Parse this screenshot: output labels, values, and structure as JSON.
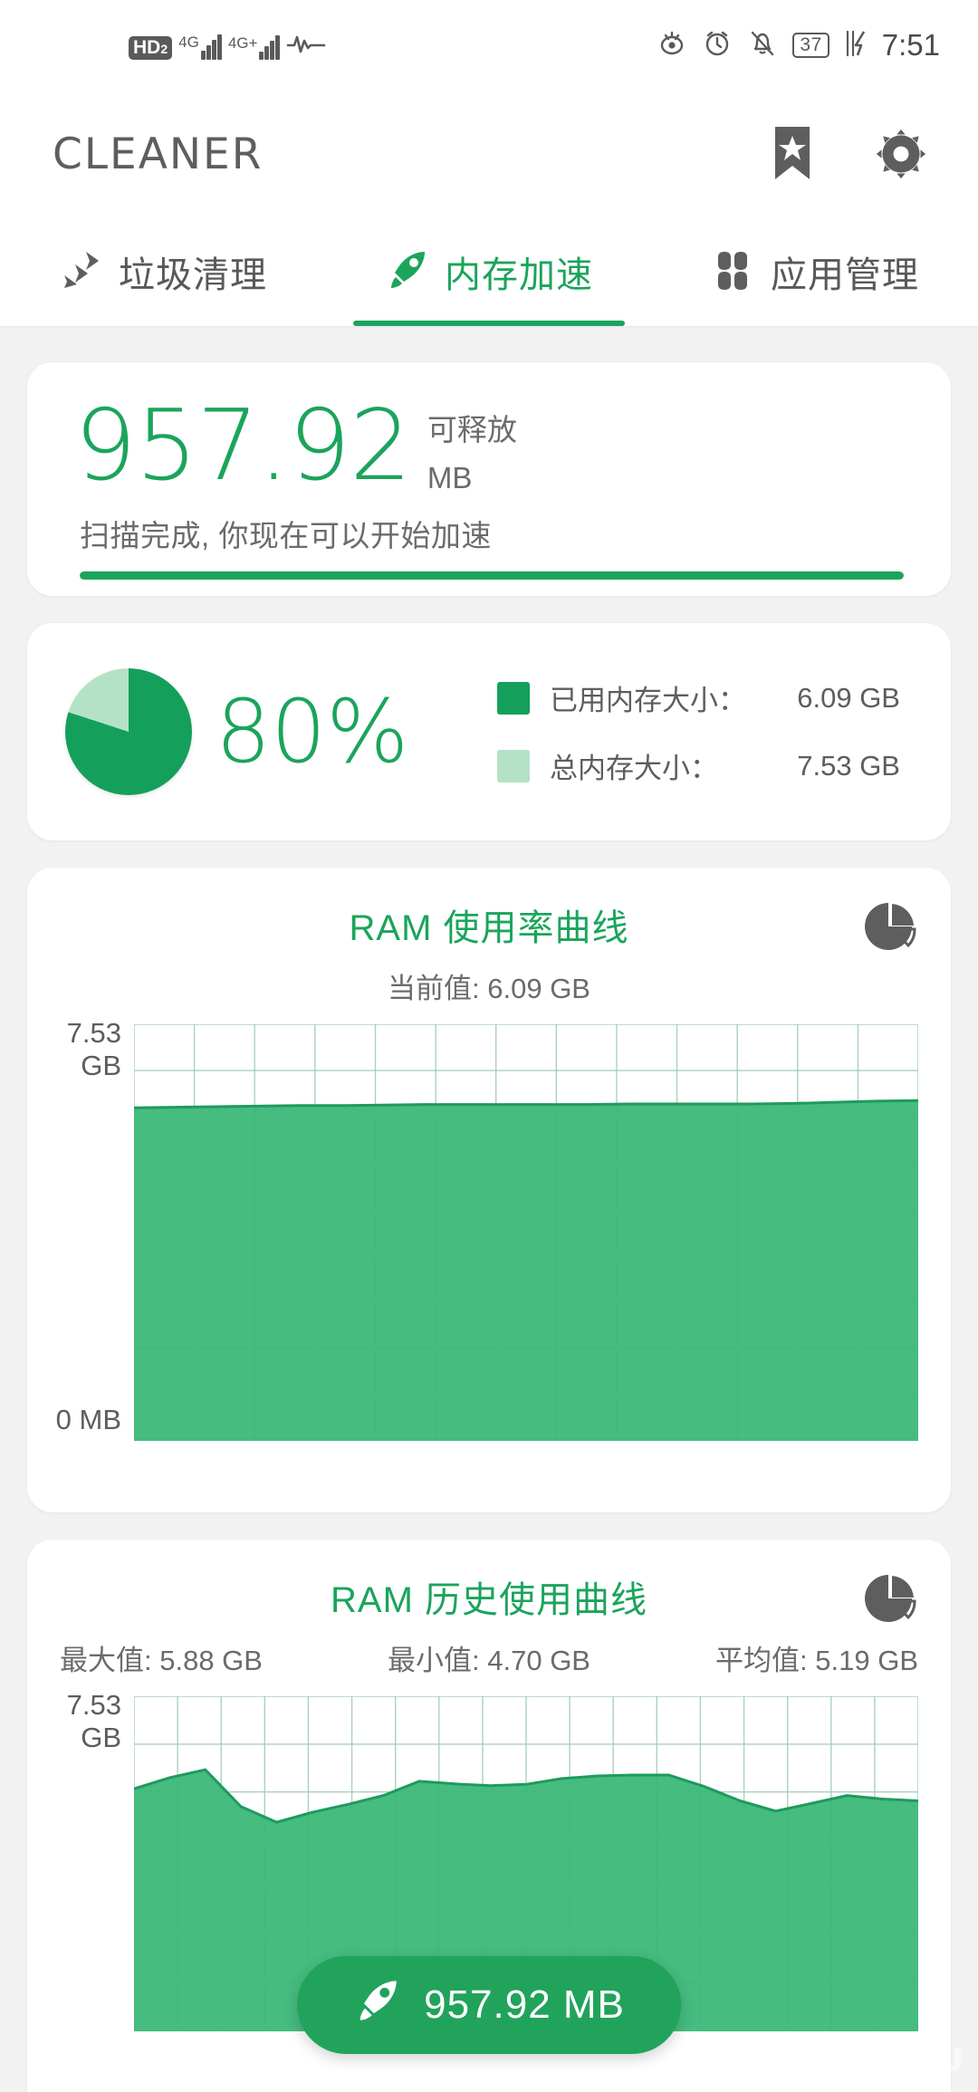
{
  "statusbar": {
    "hd_label": "HD",
    "hd_sub": "2",
    "net_1": "4G",
    "net_2": "4G+",
    "battery": "37",
    "time": "7:51",
    "icons": [
      "hd-badge-icon",
      "signal-4g-icon",
      "signal-4g-plus-icon",
      "waveform-icon",
      "eye-care-icon",
      "alarm-icon",
      "mute-bell-icon",
      "battery-icon",
      "charging-bolt-icon"
    ]
  },
  "appbar": {
    "title": "CLEANER",
    "bookmark_icon": "bookmark-star-icon",
    "settings_icon": "gear-icon"
  },
  "tabs": [
    {
      "label": "垃圾清理",
      "icon": "broom-icon",
      "active": false
    },
    {
      "label": "内存加速",
      "icon": "rocket-icon",
      "active": true
    },
    {
      "label": "应用管理",
      "icon": "apps-grid-icon",
      "active": false
    }
  ],
  "scan_card": {
    "amount": "957.92",
    "unit_top": "可释放",
    "unit_bottom": "MB",
    "status_text": "扫描完成, 你现在可以开始加速",
    "progress_percent": 100
  },
  "memory_card": {
    "percent_label": "80%",
    "percent_value": 80,
    "legend": [
      {
        "label": "已用内存大小：",
        "value": "6.09 GB",
        "color": "#14a05a"
      },
      {
        "label": "总内存大小：",
        "value": "7.53 GB",
        "color": "#b4e2c7"
      }
    ]
  },
  "colors": {
    "accent": "#1ba45c",
    "area_fill": "#3cb878",
    "area_line": "#1f9a5f",
    "grid": "#9dc9b4",
    "text": "#5d5d5d"
  },
  "ram_card": {
    "title": "RAM 使用率曲线",
    "subtitle": "当前值: 6.09 GB",
    "icon": "pie-chart-icon",
    "y_top": "7.53\nGB",
    "y_top_line1": "7.53",
    "y_top_line2": "GB",
    "y_bottom": "0 MB"
  },
  "history_card": {
    "title": "RAM 历史使用曲线",
    "icon": "pie-chart-icon",
    "stats": [
      {
        "label": "最大值: 5.88 GB"
      },
      {
        "label": "最小值: 4.70 GB"
      },
      {
        "label": "平均值: 5.19 GB"
      }
    ],
    "y_top_line1": "7.53",
    "y_top_line2": "GB"
  },
  "fab": {
    "label": "957.92 MB",
    "icon": "rocket-icon"
  },
  "watermark": "UEBU",
  "chart_data": [
    {
      "type": "area",
      "title": "RAM 使用率曲线",
      "subtitle": "当前值: 6.09 GB",
      "ylabel": "",
      "xlabel": "",
      "ylim": [
        0,
        7.53
      ],
      "ytick_labels": [
        "0 MB",
        "7.53 GB"
      ],
      "grid": true,
      "unit": "GB",
      "values": [
        6.02,
        6.03,
        6.04,
        6.05,
        6.06,
        6.06,
        6.07,
        6.08,
        6.08,
        6.08,
        6.08,
        6.08,
        6.09,
        6.09,
        6.09,
        6.09,
        6.1,
        6.12,
        6.14,
        6.15
      ],
      "current_value": 6.09
    },
    {
      "type": "area",
      "title": "RAM 历史使用曲线",
      "ylabel": "",
      "xlabel": "",
      "ylim": [
        0,
        7.53
      ],
      "ytick_labels": [
        "7.53 GB"
      ],
      "grid": true,
      "unit": "GB",
      "max": 5.88,
      "min": 4.7,
      "avg": 5.19,
      "values": [
        5.45,
        5.7,
        5.88,
        5.05,
        4.7,
        4.92,
        5.1,
        5.3,
        5.62,
        5.56,
        5.52,
        5.55,
        5.68,
        5.74,
        5.76,
        5.76,
        5.5,
        5.18,
        4.95,
        5.12,
        5.3,
        5.22,
        5.18
      ]
    }
  ]
}
